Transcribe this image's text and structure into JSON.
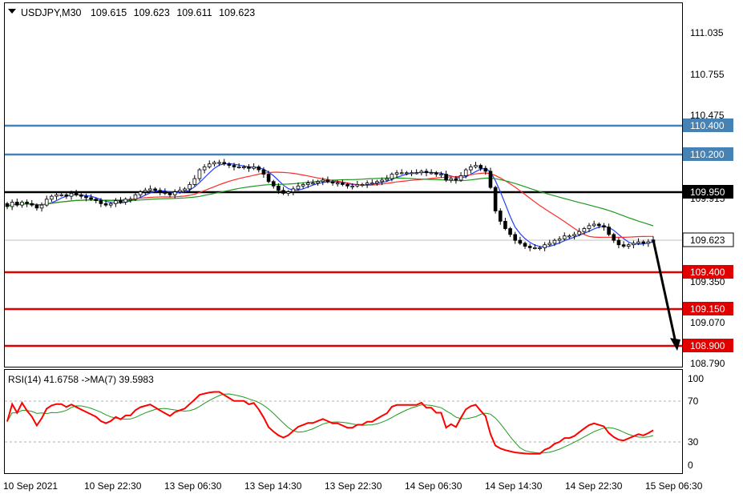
{
  "header": {
    "symbol": "USDJPY,M30",
    "open": "109.615",
    "high": "109.623",
    "low": "109.611",
    "close": "109.623"
  },
  "rsi_header": "RSI(14) 41.6758  ->MA(7) 39.5983",
  "colors": {
    "resistance": "#4682b4",
    "support": "#e00000",
    "pivot": "#000000",
    "ma_fast": "#1f3fff",
    "ma_mid": "#ff2a2a",
    "ma_slow": "#1f9a1f",
    "rsi": "#ff0000",
    "rsi_ma": "#1f9a1f"
  },
  "chart_data": [
    {
      "type": "candlestick",
      "symbol": "USDJPY",
      "timeframe": "M30",
      "ylim": [
        108.79,
        111.175
      ],
      "y_ticks": [
        "111.035",
        "110.755",
        "110.475",
        "109.915",
        "109.350",
        "109.070",
        "108.790"
      ],
      "levels": [
        {
          "value": 110.4,
          "label": "110.400",
          "kind": "resistance"
        },
        {
          "value": 110.2,
          "label": "110.200",
          "kind": "resistance"
        },
        {
          "value": 109.95,
          "label": "109.950",
          "kind": "pivot"
        },
        {
          "value": 109.623,
          "label": "109.623",
          "kind": "current"
        },
        {
          "value": 109.4,
          "label": "109.400",
          "kind": "support"
        },
        {
          "value": 109.15,
          "label": "109.150",
          "kind": "support"
        },
        {
          "value": 108.9,
          "label": "108.900",
          "kind": "support"
        }
      ],
      "x_labels": [
        "10 Sep 2021",
        "10 Sep 22:30",
        "13 Sep 06:30",
        "13 Sep 14:30",
        "13 Sep 22:30",
        "14 Sep 06:30",
        "14 Sep 14:30",
        "14 Sep 22:30",
        "15 Sep 06:30"
      ],
      "closes": [
        109.85,
        109.88,
        109.86,
        109.88,
        109.87,
        109.86,
        109.84,
        109.86,
        109.9,
        109.92,
        109.93,
        109.93,
        109.92,
        109.94,
        109.93,
        109.92,
        109.91,
        109.9,
        109.89,
        109.87,
        109.86,
        109.87,
        109.89,
        109.88,
        109.9,
        109.9,
        109.93,
        109.95,
        109.96,
        109.97,
        109.96,
        109.95,
        109.94,
        109.93,
        109.95,
        109.96,
        109.97,
        110.0,
        110.04,
        110.1,
        110.12,
        110.14,
        110.15,
        110.15,
        110.14,
        110.13,
        110.12,
        110.12,
        110.12,
        110.11,
        110.12,
        110.1,
        110.07,
        110.02,
        109.99,
        109.96,
        109.94,
        109.95,
        109.97,
        109.99,
        110.0,
        110.01,
        110.01,
        110.02,
        110.03,
        110.02,
        110.01,
        110.01,
        110.0,
        109.99,
        109.99,
        110.0,
        110.0,
        110.01,
        110.01,
        110.02,
        110.03,
        110.04,
        110.07,
        110.08,
        110.08,
        110.08,
        110.08,
        110.08,
        110.09,
        110.08,
        110.08,
        110.07,
        110.07,
        110.03,
        110.04,
        110.03,
        110.06,
        110.1,
        110.12,
        110.13,
        110.11,
        110.09,
        109.98,
        109.82,
        109.75,
        109.7,
        109.66,
        109.62,
        109.6,
        109.58,
        109.57,
        109.57,
        109.57,
        109.59,
        109.6,
        109.62,
        109.63,
        109.65,
        109.65,
        109.66,
        109.68,
        109.7,
        109.72,
        109.73,
        109.72,
        109.71,
        109.66,
        109.62,
        109.59,
        109.58,
        109.59,
        109.6,
        109.61,
        109.6,
        109.61,
        109.623
      ],
      "moving_averages": [
        {
          "color_key": "ma_fast",
          "period": 5
        },
        {
          "color_key": "ma_mid",
          "period": 20
        },
        {
          "color_key": "ma_slow",
          "period": 40
        }
      ],
      "forecast_arrow": {
        "from": 109.623,
        "to": 108.88
      }
    },
    {
      "type": "line",
      "indicator": "RSI",
      "period": 14,
      "ma_period": 7,
      "value": 41.6758,
      "ma_value": 39.5983,
      "ylim": [
        0,
        100
      ],
      "y_ticks": [
        "100",
        "70",
        "30",
        "0"
      ],
      "levels": [
        70,
        30
      ]
    }
  ]
}
